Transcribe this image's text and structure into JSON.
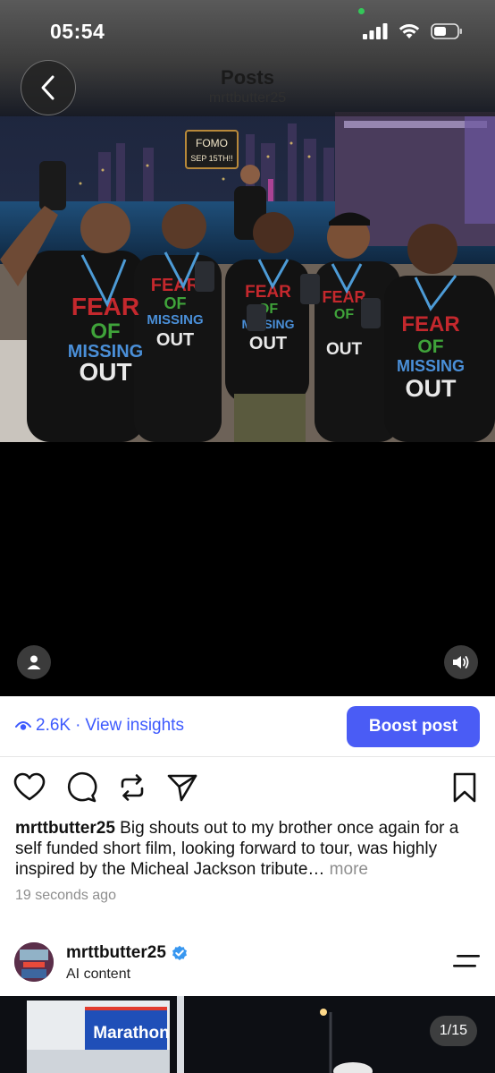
{
  "status_bar": {
    "time": "05:54"
  },
  "header": {
    "title": "Posts",
    "username": "mrttbutter25"
  },
  "photo": {
    "sign_line1": "FOMO",
    "sign_line2": "SEP 15TH!!",
    "shirt_text": [
      "FEAR",
      "OF",
      "MISSING",
      "OUT"
    ]
  },
  "insights": {
    "views": "2.6K",
    "separator": "·",
    "link_label": "View insights",
    "boost_label": "Boost post"
  },
  "post": {
    "username": "mrttbutter25",
    "caption": " Big shouts out to my brother once again for a self funded short film, looking forward to tour, was highly inspired by the Micheal Jackson tribute…",
    "more_label": " more",
    "time_ago": "19 seconds ago"
  },
  "next_post": {
    "username": "mrttbutter25",
    "label": "AI content",
    "sign_text": "Marathon",
    "counter": "1/15"
  },
  "icons": {
    "back": "chevron-left-icon",
    "person": "person-icon",
    "volume": "volume-icon",
    "eye": "eye-icon",
    "like": "heart-icon",
    "comment": "comment-icon",
    "repost": "repost-icon",
    "share": "send-icon",
    "save": "bookmark-icon",
    "verified": "verified-icon",
    "menu": "menu-icon"
  },
  "colors": {
    "accent": "#4a5cf5",
    "link": "#3d5afe",
    "verified": "#3897f0",
    "muted": "#8e8e8e"
  }
}
